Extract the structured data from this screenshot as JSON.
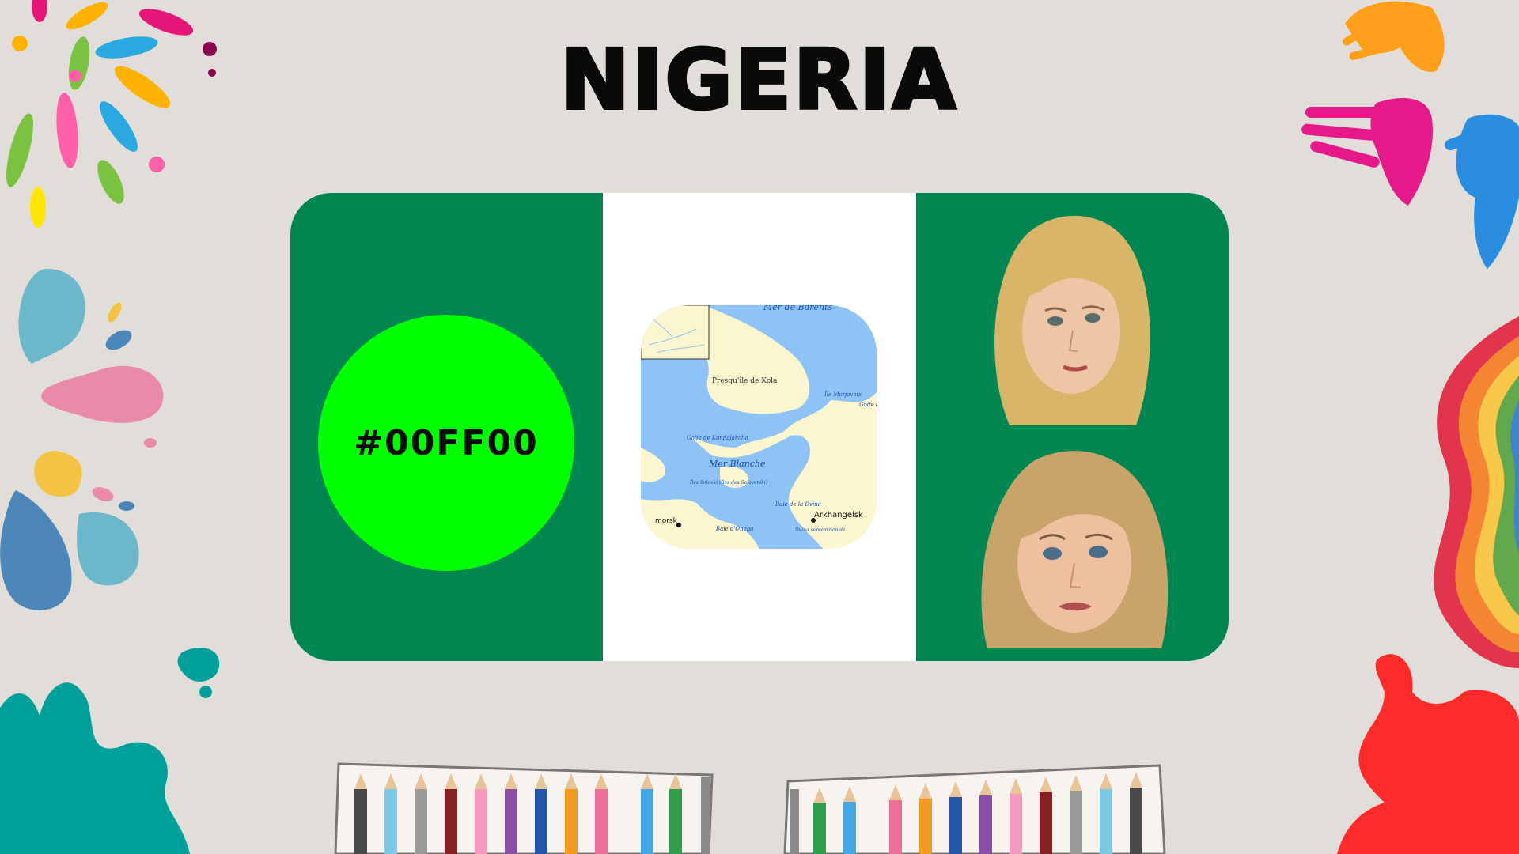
{
  "page": {
    "title": "NIGERIA",
    "background_color": "#e1ddd8"
  },
  "flag": {
    "green_color": "#008751",
    "white_color": "#ffffff",
    "swatch": {
      "label": "#00FF00",
      "color": "#00ff00"
    },
    "map": {
      "labels": [
        "Mer de Barents",
        "Presqu'île de Kola",
        "Île Morjovets",
        "Golfe de Mezen",
        "Golfe de Kandalakcha",
        "Mer Blanche",
        "Îles Solovki (Îles des Solovetski)",
        "Baie de la Dvina",
        "Arkhangelsk",
        "Dvina septentrionale",
        "Baie d'Onega",
        "morsk"
      ]
    },
    "photos": [
      "blonde-woman-side-glance",
      "blonde-woman-worried"
    ]
  },
  "decorations": {
    "colors": [
      "#ff3fa4",
      "#ffb300",
      "#2aa9e0",
      "#7cc242",
      "#ff7a00",
      "#e5167a",
      "#00a19a",
      "#ff2d2d",
      "#ffe600"
    ]
  }
}
